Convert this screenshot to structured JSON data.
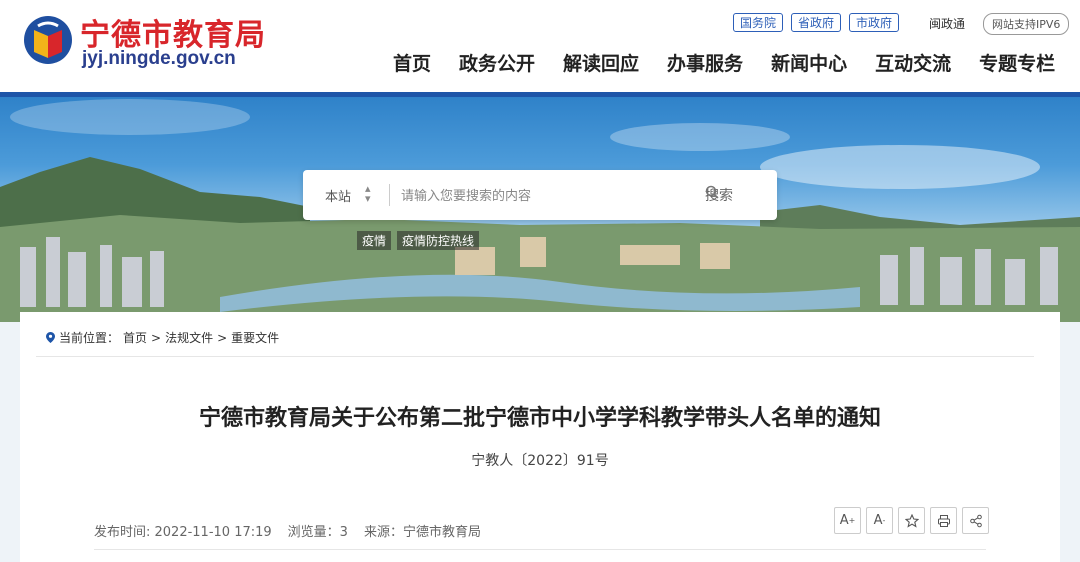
{
  "header": {
    "site_name": "宁德市教育局",
    "site_domain": "jyj.ningde.gov.cn",
    "top_links": [
      "国务院",
      "省政府",
      "市政府"
    ],
    "min_tong": "闽政通",
    "ipv6": "网站支持IPV6",
    "nav": [
      "首页",
      "政务公开",
      "解读回应",
      "办事服务",
      "新闻中心",
      "互动交流",
      "专题专栏"
    ]
  },
  "search": {
    "scope": "本站",
    "placeholder": "请输入您要搜索的内容",
    "button": "搜索",
    "hot_tags": [
      "疫情",
      "疫情防控热线"
    ]
  },
  "breadcrumb": {
    "label": "当前位置：",
    "items": [
      "首页",
      "法规文件",
      "重要文件"
    ]
  },
  "article": {
    "title": "宁德市教育局关于公布第二批宁德市中小学学科教学带头人名单的通知",
    "doc_no": "宁教人〔2022〕91号",
    "publish_time": "发布时间: 2022-11-10 17:19",
    "views": "浏览量：3",
    "source": "来源：宁德市教育局"
  },
  "tools": {
    "font_up": "A",
    "font_down": "A"
  },
  "colors": {
    "brand_red": "#d8262b",
    "brand_blue": "#1e55a8"
  }
}
